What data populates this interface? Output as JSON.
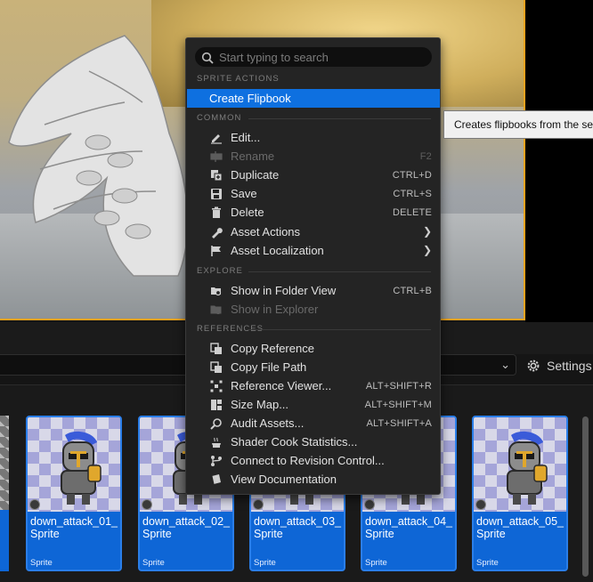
{
  "menu": {
    "search": {
      "placeholder": "Start typing to search"
    },
    "sections": {
      "sprite_actions": "SPRITE ACTIONS",
      "common": "COMMON",
      "explore": "EXPLORE",
      "references": "REFERENCES"
    },
    "sprite_actions": [
      {
        "label": "Create Flipbook",
        "icon": "flipbook-icon",
        "active": true
      }
    ],
    "common": [
      {
        "label": "Edit...",
        "icon": "pencil-icon",
        "shortcut": ""
      },
      {
        "label": "Rename",
        "icon": "rename-icon",
        "shortcut": "F2",
        "disabled": true
      },
      {
        "label": "Duplicate",
        "icon": "duplicate-icon",
        "shortcut": "CTRL+D"
      },
      {
        "label": "Save",
        "icon": "save-icon",
        "shortcut": "CTRL+S"
      },
      {
        "label": "Delete",
        "icon": "trash-icon",
        "shortcut": "DELETE"
      },
      {
        "label": "Asset Actions",
        "icon": "wrench-icon",
        "submenu": true
      },
      {
        "label": "Asset Localization",
        "icon": "flag-icon",
        "submenu": true
      }
    ],
    "explore": [
      {
        "label": "Show in Folder View",
        "icon": "folder-search-icon",
        "shortcut": "CTRL+B"
      },
      {
        "label": "Show in Explorer",
        "icon": "explorer-icon",
        "shortcut": "",
        "disabled": true
      }
    ],
    "references": [
      {
        "label": "Copy Reference",
        "icon": "copy-reference-icon",
        "shortcut": ""
      },
      {
        "label": "Copy File Path",
        "icon": "copy-path-icon",
        "shortcut": ""
      },
      {
        "label": "Reference Viewer...",
        "icon": "reference-viewer-icon",
        "shortcut": "ALT+SHIFT+R"
      },
      {
        "label": "Size Map...",
        "icon": "size-map-icon",
        "shortcut": "ALT+SHIFT+M"
      },
      {
        "label": "Audit Assets...",
        "icon": "audit-icon",
        "shortcut": "ALT+SHIFT+A"
      },
      {
        "label": "Shader Cook Statistics...",
        "icon": "teapot-icon",
        "shortcut": ""
      },
      {
        "label": "Connect to Revision Control...",
        "icon": "branch-icon",
        "shortcut": ""
      },
      {
        "label": "View Documentation",
        "icon": "book-icon",
        "shortcut": ""
      }
    ]
  },
  "tooltip": {
    "text": "Creates flipbooks from the se"
  },
  "toolbar": {
    "settings_label": "Settings"
  },
  "assets": [
    {
      "name": "down_attack_01_\nSprite",
      "type": "Sprite"
    },
    {
      "name": "down_attack_02_\nSprite",
      "type": "Sprite"
    },
    {
      "name": "down_attack_03_\nSprite",
      "type": "Sprite"
    },
    {
      "name": "down_attack_04_\nSprite",
      "type": "Sprite"
    },
    {
      "name": "down_attack_05_\nSprite",
      "type": "Sprite"
    }
  ],
  "colors": {
    "accent": "#0e70e0",
    "tile": "#0e66d6",
    "viewport_border": "#e8a21f",
    "menu_bg": "#242424"
  }
}
